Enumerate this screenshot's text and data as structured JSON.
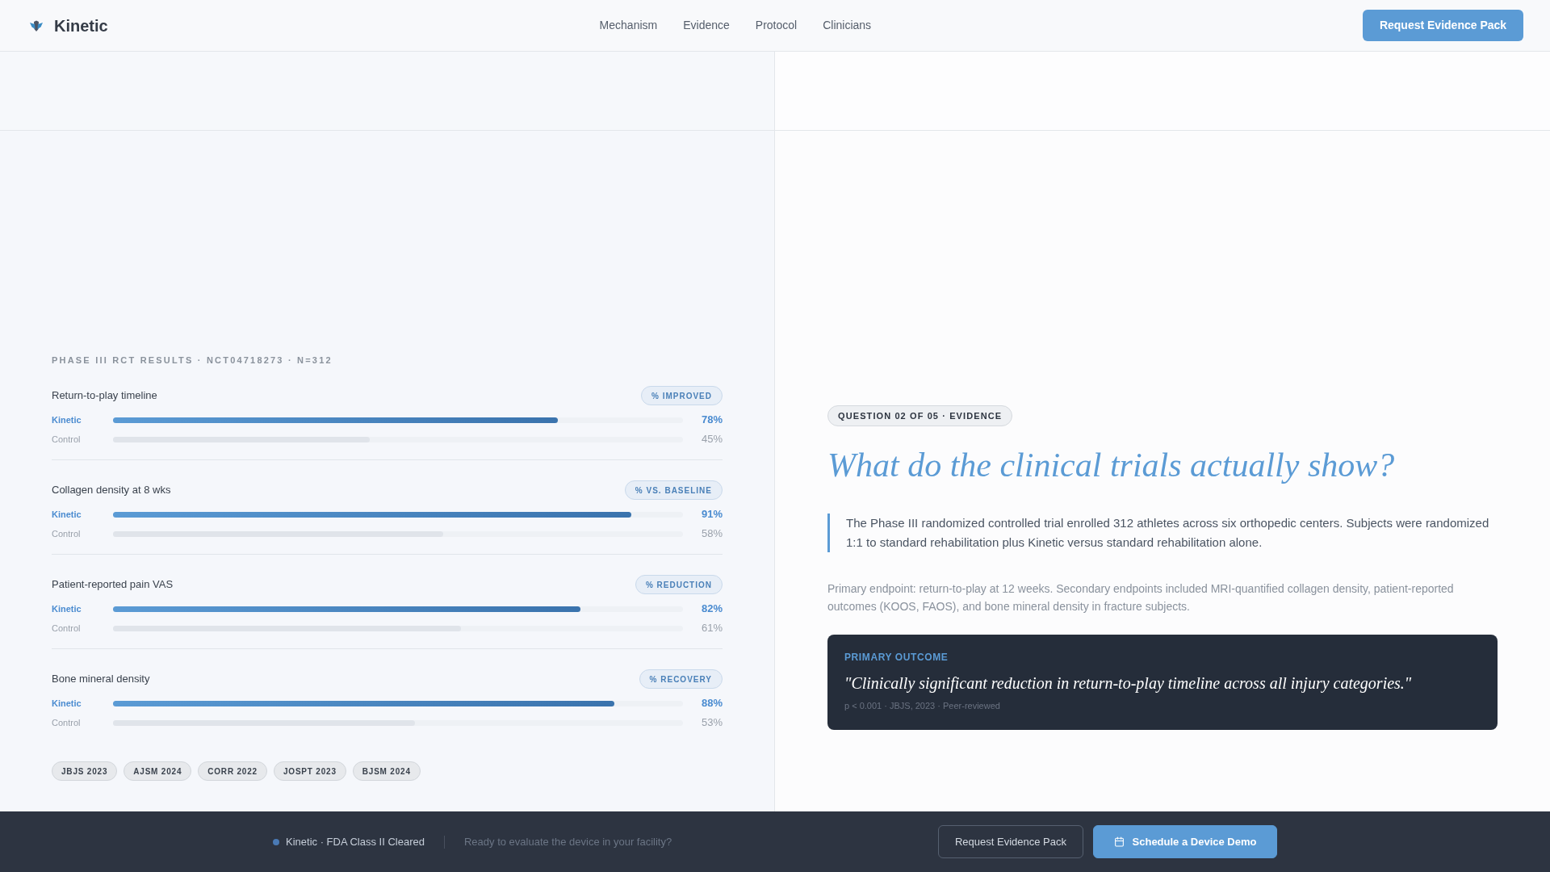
{
  "header": {
    "brand": "Kinetic",
    "nav": [
      {
        "label": "Mechanism"
      },
      {
        "label": "Evidence"
      },
      {
        "label": "Protocol"
      },
      {
        "label": "Clinicians"
      }
    ],
    "cta": "Request Evidence Pack"
  },
  "results": {
    "heading": "PHASE III RCT RESULTS · NCT04718273 · N=312",
    "metrics": [
      {
        "title": "Return-to-play timeline",
        "badge": "% IMPROVED",
        "bars": [
          {
            "kind": "treatment",
            "label": "Kinetic",
            "level": 0.78,
            "reading": "78%"
          },
          {
            "kind": "control",
            "label": "Control",
            "level": 0.45,
            "reading": "45%"
          }
        ]
      },
      {
        "title": "Collagen density at 8 wks",
        "badge": "% VS. BASELINE",
        "bars": [
          {
            "kind": "treatment",
            "label": "Kinetic",
            "level": 0.91,
            "reading": "91%"
          },
          {
            "kind": "control",
            "label": "Control",
            "level": 0.58,
            "reading": "58%"
          }
        ]
      },
      {
        "title": "Patient-reported pain VAS",
        "badge": "% REDUCTION",
        "bars": [
          {
            "kind": "treatment",
            "label": "Kinetic",
            "level": 0.82,
            "reading": "82%"
          },
          {
            "kind": "control",
            "label": "Control",
            "level": 0.61,
            "reading": "61%"
          }
        ]
      },
      {
        "title": "Bone mineral density",
        "badge": "% RECOVERY",
        "bars": [
          {
            "kind": "treatment",
            "label": "Kinetic",
            "level": 0.88,
            "reading": "88%"
          },
          {
            "kind": "control",
            "label": "Control",
            "level": 0.53,
            "reading": "53%"
          }
        ]
      }
    ],
    "journals": [
      "JBJS 2023",
      "AJSM 2024",
      "CORR 2022",
      "JOSPT 2023",
      "BJSM 2024"
    ]
  },
  "question": {
    "badge": "QUESTION 02 OF 05 · EVIDENCE",
    "title": "What do the clinical trials actually show?",
    "lead": "The Phase III randomized controlled trial enrolled 312 athletes across six orthopedic centers. Subjects were randomized 1:1 to standard rehabilitation plus Kinetic versus standard rehabilitation alone.",
    "body": "Primary endpoint: return-to-play at 12 weeks. Secondary endpoints included MRI-quantified collagen density, patient-reported outcomes (KOOS, FAOS), and bone mineral density in fracture subjects.",
    "outcome": {
      "label": "PRIMARY OUTCOME",
      "quote": "\"Clinically significant reduction in return-to-play timeline across all injury categories.\"",
      "meta": "p < 0.001 · JBJS, 2023 · Peer-reviewed"
    }
  },
  "footer": {
    "status": "Kinetic · FDA Class II Cleared",
    "prompt": "Ready to evaluate the device in your facility?",
    "buttons": [
      {
        "kind": "secondary",
        "label": "Request Evidence Pack"
      },
      {
        "kind": "primary",
        "label": "Schedule a Device Demo"
      }
    ]
  }
}
